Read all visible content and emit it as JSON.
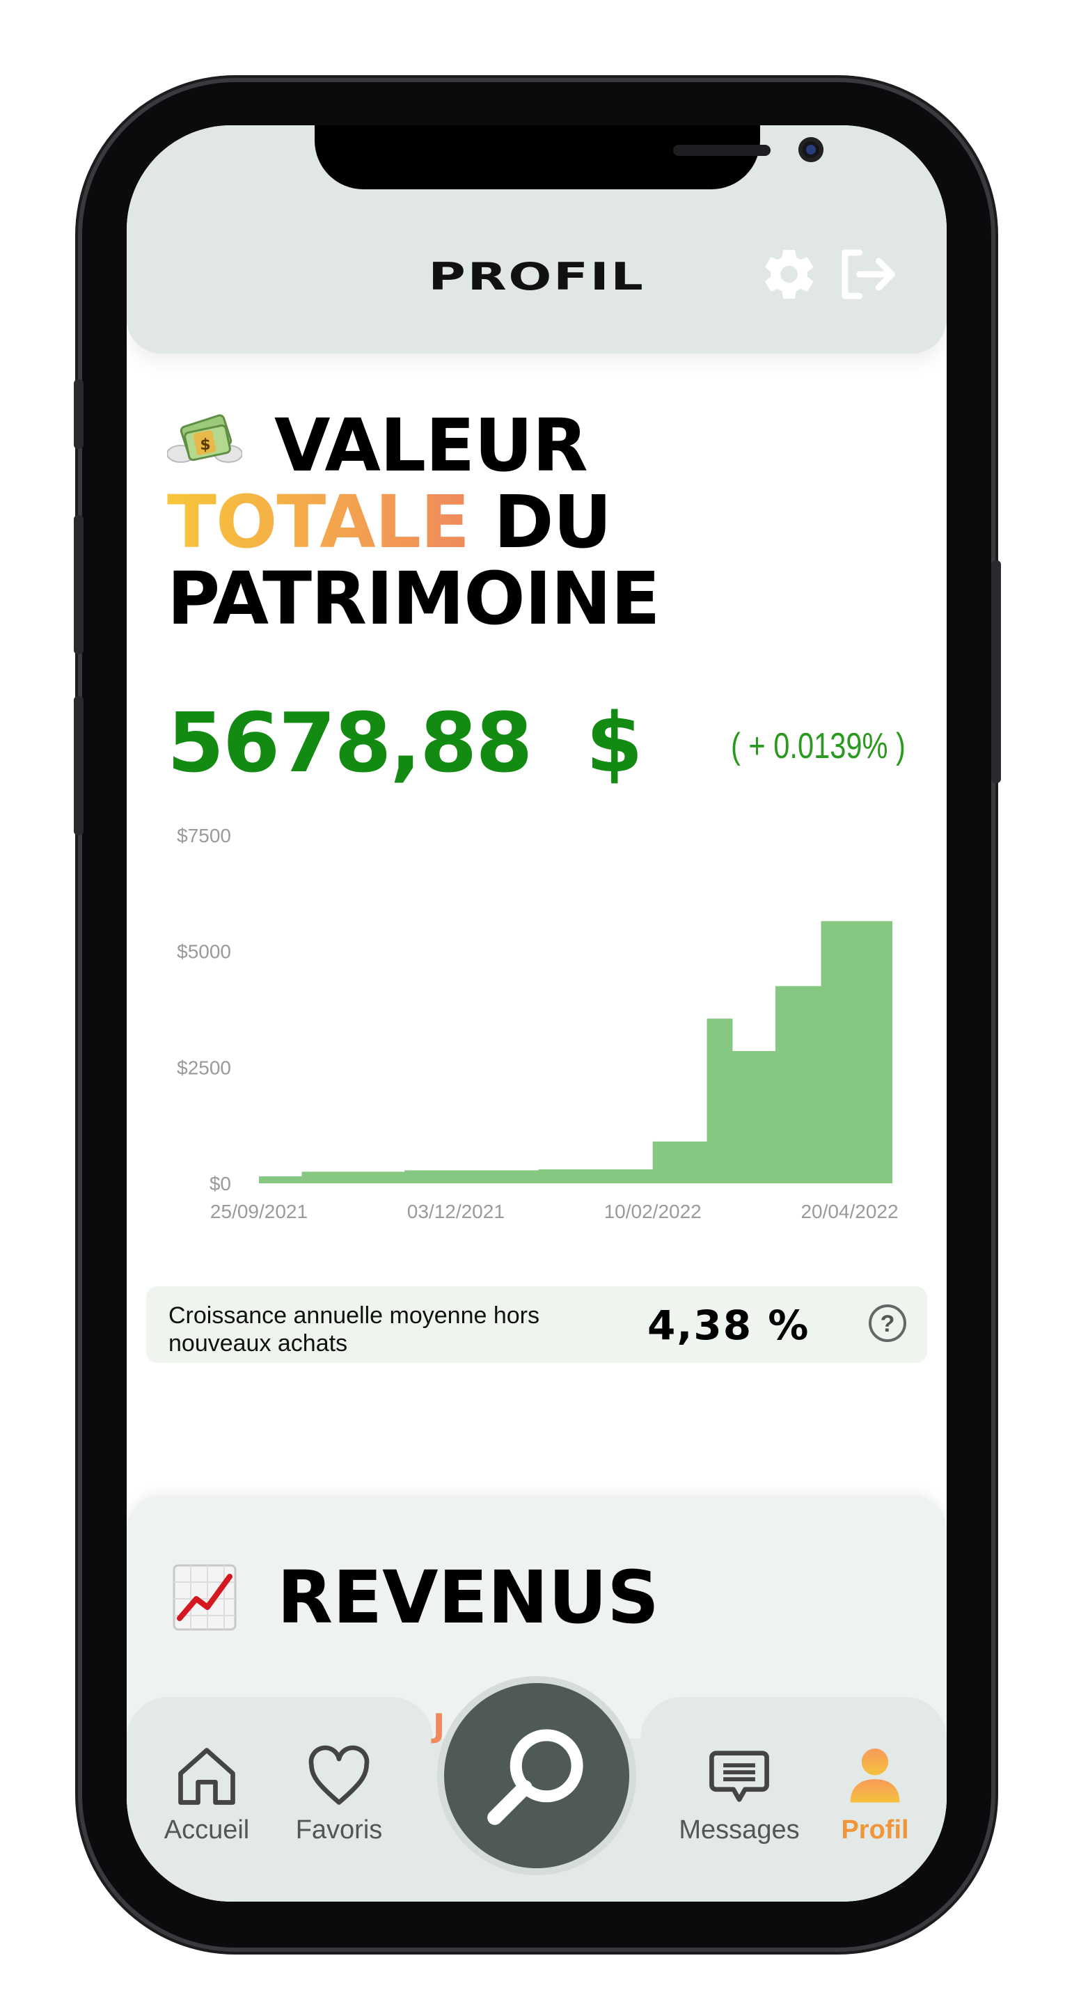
{
  "header": {
    "title": "PROFIL"
  },
  "wealth": {
    "title_line1": "VALEUR",
    "title_line2_highlight": "TOTALE",
    "title_line2_rest": "DU",
    "title_line3": "PATRIMOINE",
    "amount": "5678,88",
    "currency": "$",
    "change": "( + 0.0139% )"
  },
  "chart_data": {
    "type": "area",
    "x": [
      "25/09/2021",
      "03/12/2021",
      "10/02/2022",
      "20/04/2022"
    ],
    "x_tick_labels": [
      "25/09/2021",
      "03/12/2021",
      "10/02/2022",
      "20/04/2022"
    ],
    "y_tick_labels": [
      "$0",
      "$2500",
      "$5000",
      "$7500"
    ],
    "ylim": [
      0,
      7500
    ],
    "points": [
      {
        "x": "25/09/2021",
        "y": 150
      },
      {
        "x": "10/10/2021",
        "y": 250
      },
      {
        "x": "15/11/2021",
        "y": 280
      },
      {
        "x": "01/01/2022",
        "y": 300
      },
      {
        "x": "10/02/2022",
        "y": 900
      },
      {
        "x": "01/03/2022",
        "y": 3550
      },
      {
        "x": "10/03/2022",
        "y": 2850
      },
      {
        "x": "25/03/2022",
        "y": 4250
      },
      {
        "x": "10/04/2022",
        "y": 5650
      },
      {
        "x": "05/05/2022",
        "y": 5678.88
      }
    ],
    "color": "#86c882",
    "grid": false
  },
  "growth": {
    "label": "Croissance annuelle moyenne hors nouveaux achats",
    "value": "4,38 %",
    "help": "?"
  },
  "revenus": {
    "title": "REVENUS"
  },
  "tabbar": {
    "peek_text": "J",
    "items": [
      {
        "label": "Accueil",
        "icon": "home-icon"
      },
      {
        "label": "Favoris",
        "icon": "heart-icon"
      },
      {
        "label": "",
        "icon": "search-icon"
      },
      {
        "label": "Messages",
        "icon": "messages-icon"
      },
      {
        "label": "Profil",
        "icon": "profile-icon"
      }
    ]
  },
  "colors": {
    "accent_green": "#138a12",
    "accent_orange": "#f0963a",
    "chart_fill": "#86c882"
  }
}
